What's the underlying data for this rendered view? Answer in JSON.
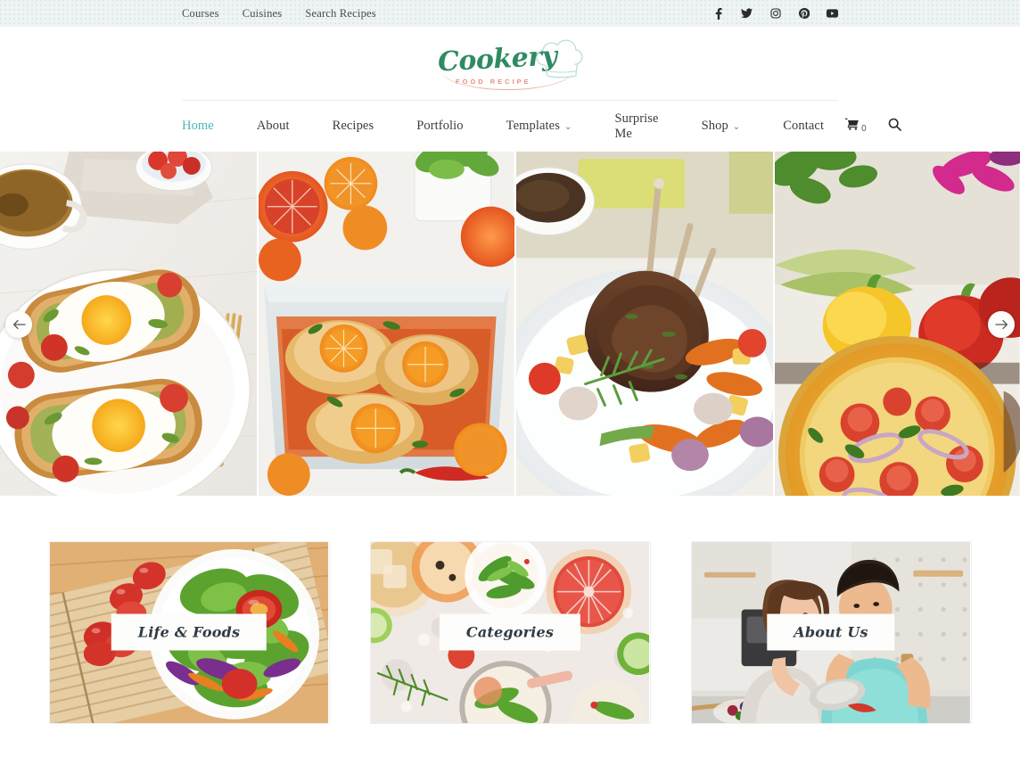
{
  "topbar": {
    "links": [
      {
        "label": "Courses"
      },
      {
        "label": "Cuisines"
      },
      {
        "label": "Search Recipes"
      }
    ],
    "social": [
      {
        "name": "facebook-icon"
      },
      {
        "name": "twitter-icon"
      },
      {
        "name": "instagram-icon"
      },
      {
        "name": "pinterest-icon"
      },
      {
        "name": "youtube-icon"
      }
    ],
    "bg_color": "#eef3f4"
  },
  "logo": {
    "word": "Cookery",
    "tagline": "FOOD RECIPE",
    "word_color": "#2e8b62",
    "tagline_color": "#e8907e",
    "mark": "chef-hat-icon"
  },
  "mainnav": {
    "items": [
      {
        "label": "Home",
        "active": true,
        "caret": ""
      },
      {
        "label": "About",
        "active": false,
        "caret": ""
      },
      {
        "label": "Recipes",
        "active": false,
        "caret": ""
      },
      {
        "label": "Portfolio",
        "active": false,
        "caret": ""
      },
      {
        "label": "Templates",
        "active": false,
        "caret": "⌄"
      },
      {
        "label": "Surprise Me",
        "active": false,
        "caret": ""
      },
      {
        "label": "Shop",
        "active": false,
        "caret": "⌄"
      },
      {
        "label": "Contact",
        "active": false,
        "caret": ""
      }
    ],
    "active_color": "#4cb5b5",
    "cart_count": "0",
    "cart_icon": "shopping-cart-icon",
    "search_icon": "search-icon"
  },
  "carousel": {
    "prev_icon": "arrow-left-icon",
    "next_icon": "arrow-right-icon",
    "slides": [
      {
        "name": "avocado-toast-eggs"
      },
      {
        "name": "baked-chicken-oranges"
      },
      {
        "name": "rack-of-lamb-vegetables"
      },
      {
        "name": "vegetable-pizza"
      }
    ]
  },
  "cards": [
    {
      "label": "Life & Foods",
      "name": "card-life-and-foods"
    },
    {
      "label": "Categories",
      "name": "card-categories"
    },
    {
      "label": "About Us",
      "name": "card-about-us"
    }
  ]
}
